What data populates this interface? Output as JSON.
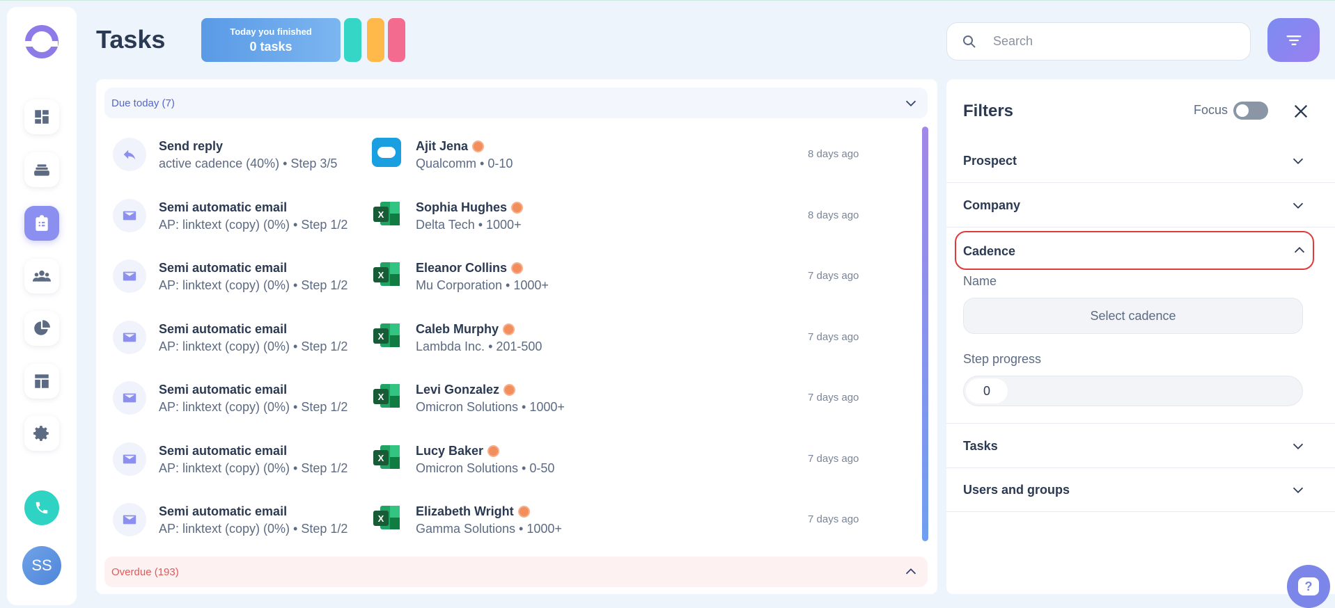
{
  "header": {
    "title": "Tasks",
    "finished_label": "Today you finished",
    "finished_value": "0 tasks",
    "pills": [
      "#36d6c6",
      "#ffb84a",
      "#f36b8e"
    ],
    "search_placeholder": "Search"
  },
  "sidebar": {
    "avatar_initials": "SS",
    "items": [
      "dashboard-icon",
      "inbox-icon",
      "tasks-icon",
      "contacts-icon",
      "reports-icon",
      "templates-icon",
      "settings-icon"
    ]
  },
  "tasks": {
    "due_label": "Due today (7)",
    "overdue_label": "Overdue (193)",
    "rows": [
      {
        "type": "reply",
        "title": "Send reply",
        "sub": "active cadence (40%) • Step 3/5",
        "crm": "salesforce",
        "name": "Ajit Jena",
        "company": "Qualcomm • 0-10",
        "time": "8 days ago"
      },
      {
        "type": "email",
        "title": "Semi automatic email",
        "sub": "AP: linktext (copy) (0%) • Step 1/2",
        "crm": "excel",
        "name": "Sophia Hughes",
        "company": "Delta Tech • 1000+",
        "time": "8 days ago"
      },
      {
        "type": "email",
        "title": "Semi automatic email",
        "sub": "AP: linktext (copy) (0%) • Step 1/2",
        "crm": "excel",
        "name": "Eleanor Collins",
        "company": "Mu Corporation • 1000+",
        "time": "7 days ago"
      },
      {
        "type": "email",
        "title": "Semi automatic email",
        "sub": "AP: linktext (copy) (0%) • Step 1/2",
        "crm": "excel",
        "name": "Caleb Murphy",
        "company": "Lambda Inc. • 201-500",
        "time": "7 days ago"
      },
      {
        "type": "email",
        "title": "Semi automatic email",
        "sub": "AP: linktext (copy) (0%) • Step 1/2",
        "crm": "excel",
        "name": "Levi Gonzalez",
        "company": "Omicron Solutions • 1000+",
        "time": "7 days ago"
      },
      {
        "type": "email",
        "title": "Semi automatic email",
        "sub": "AP: linktext (copy) (0%) • Step 1/2",
        "crm": "excel",
        "name": "Lucy Baker",
        "company": "Omicron Solutions • 0-50",
        "time": "7 days ago"
      },
      {
        "type": "email",
        "title": "Semi automatic email",
        "sub": "AP: linktext (copy) (0%) • Step 1/2",
        "crm": "excel",
        "name": "Elizabeth Wright",
        "company": "Gamma Solutions • 1000+",
        "time": "7 days ago"
      }
    ]
  },
  "filters": {
    "title": "Filters",
    "focus_label": "Focus",
    "sections": {
      "prospect": "Prospect",
      "company": "Company",
      "cadence": "Cadence",
      "tasks": "Tasks",
      "users": "Users and groups"
    },
    "cadence": {
      "name_label": "Name",
      "select_label": "Select cadence",
      "step_label": "Step progress",
      "step_value": "0"
    }
  },
  "colors": {
    "accent": "#8b8ff0",
    "highlight": "#e03a3a"
  }
}
